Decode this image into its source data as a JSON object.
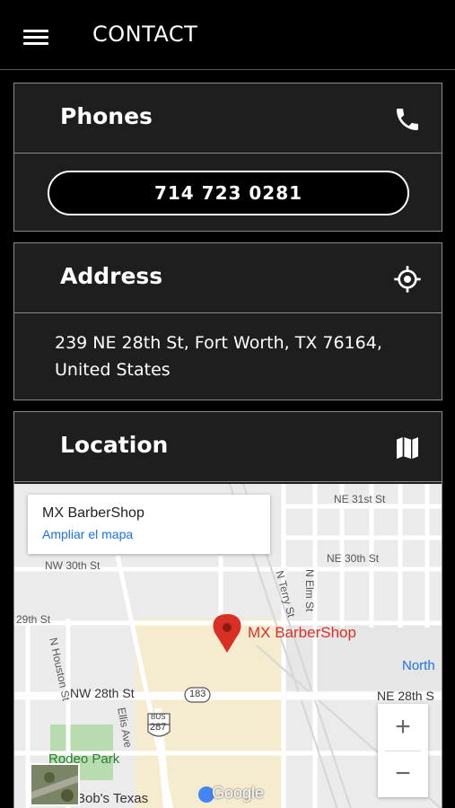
{
  "topbar": {
    "title": "CONTACT",
    "menu_icon": "hamburger-menu-icon"
  },
  "phones": {
    "title": "Phones",
    "icon": "phone-icon",
    "number": "714 723 0281"
  },
  "address": {
    "title": "Address",
    "icon": "locate-icon",
    "text": "239 NE 28th St, Fort Worth, TX 76164, United States"
  },
  "location": {
    "title": "Location",
    "icon": "map-icon",
    "map": {
      "info_name": "MX BarberShop",
      "info_link": "Ampliar el mapa",
      "marker_label": "MX BarberShop",
      "streets": {
        "ne31": "NE 31st St",
        "ne30": "NE 30th St",
        "nw30": "NW 30th St",
        "nw29": "29th St",
        "nw28": "NW 28th St",
        "ne28": "NE 28th S",
        "nhouston": "N Houston St",
        "nterry": "N Terry St",
        "nelm": "N Elm St",
        "ellis": "Ellis Ave"
      },
      "shield_183": "183",
      "shield_287": "287",
      "shield_bus": "BUS",
      "park": "Rodeo Park",
      "north": "North",
      "bottom_label": "ly Bob's Texas",
      "google": "Google",
      "zoom_in": "+",
      "zoom_out": "−"
    }
  },
  "colors": {
    "background": "#000000",
    "card": "#1e1e1e",
    "marker": "#d93025",
    "link": "#1a73e8"
  }
}
